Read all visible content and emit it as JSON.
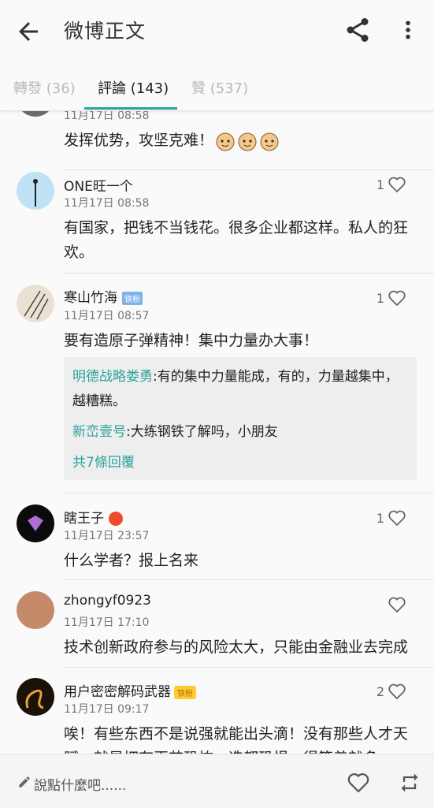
{
  "appbar": {
    "title": "微博正文",
    "back_icon": "arrow-left-icon",
    "share_icon": "share-icon",
    "more_icon": "more-vert-icon"
  },
  "tabs": [
    {
      "label": "轉發 (36)",
      "active": false
    },
    {
      "label": "評論 (143)",
      "active": true
    },
    {
      "label": "贊 (537)",
      "active": false
    }
  ],
  "comments": [
    {
      "name": "",
      "time": "11月17日 08:58",
      "likes": "",
      "text": "发挥优势，攻坚克难！",
      "emoji_count": 3
    },
    {
      "name": "ONE旺一个",
      "time": "11月17日 08:58",
      "likes": "1",
      "text": "有国家，把钱不当钱花。很多企业都这样。私人的狂欢。"
    },
    {
      "name": "寒山竹海",
      "badge": "铁粉",
      "time": "11月17日 08:57",
      "likes": "1",
      "text": "要有造原子弹精神！集中力量办大事！",
      "replies": [
        {
          "who": "明德战略娄勇",
          "text": ":有的集中力量能成，有的，力量越集中，越糟糕。"
        },
        {
          "who": "新峦壹号",
          "text": ":大练钢铁了解吗，小朋友"
        }
      ],
      "more_replies": "共7條回覆"
    },
    {
      "name": "瞎王子",
      "time": "11月17日 23:57",
      "likes": "1",
      "text": "什么学者？报上名来"
    },
    {
      "name": "zhongyf0923",
      "time": "11月17日 17:10",
      "likes": "",
      "text": "技术创新政府参与的风险太大，只能由金融业去完成"
    },
    {
      "name": "用户密密解码武器",
      "badge": "铁粉",
      "time": "11月17日 09:17",
      "likes": "2",
      "text": "唉！有些东西不是说强就能出头滴！没有那些人才天赋，就是拥有再芯恐怖，造都恐惧，得等着就多"
    }
  ],
  "bottombar": {
    "placeholder": "說點什麼吧......",
    "pen_icon": "pencil-icon",
    "like_icon": "heart-outline-icon",
    "repost_icon": "repost-icon"
  },
  "colors": {
    "accent": "#2ba39a",
    "background": "#fafafa",
    "reply_bg": "#eeeeee"
  }
}
